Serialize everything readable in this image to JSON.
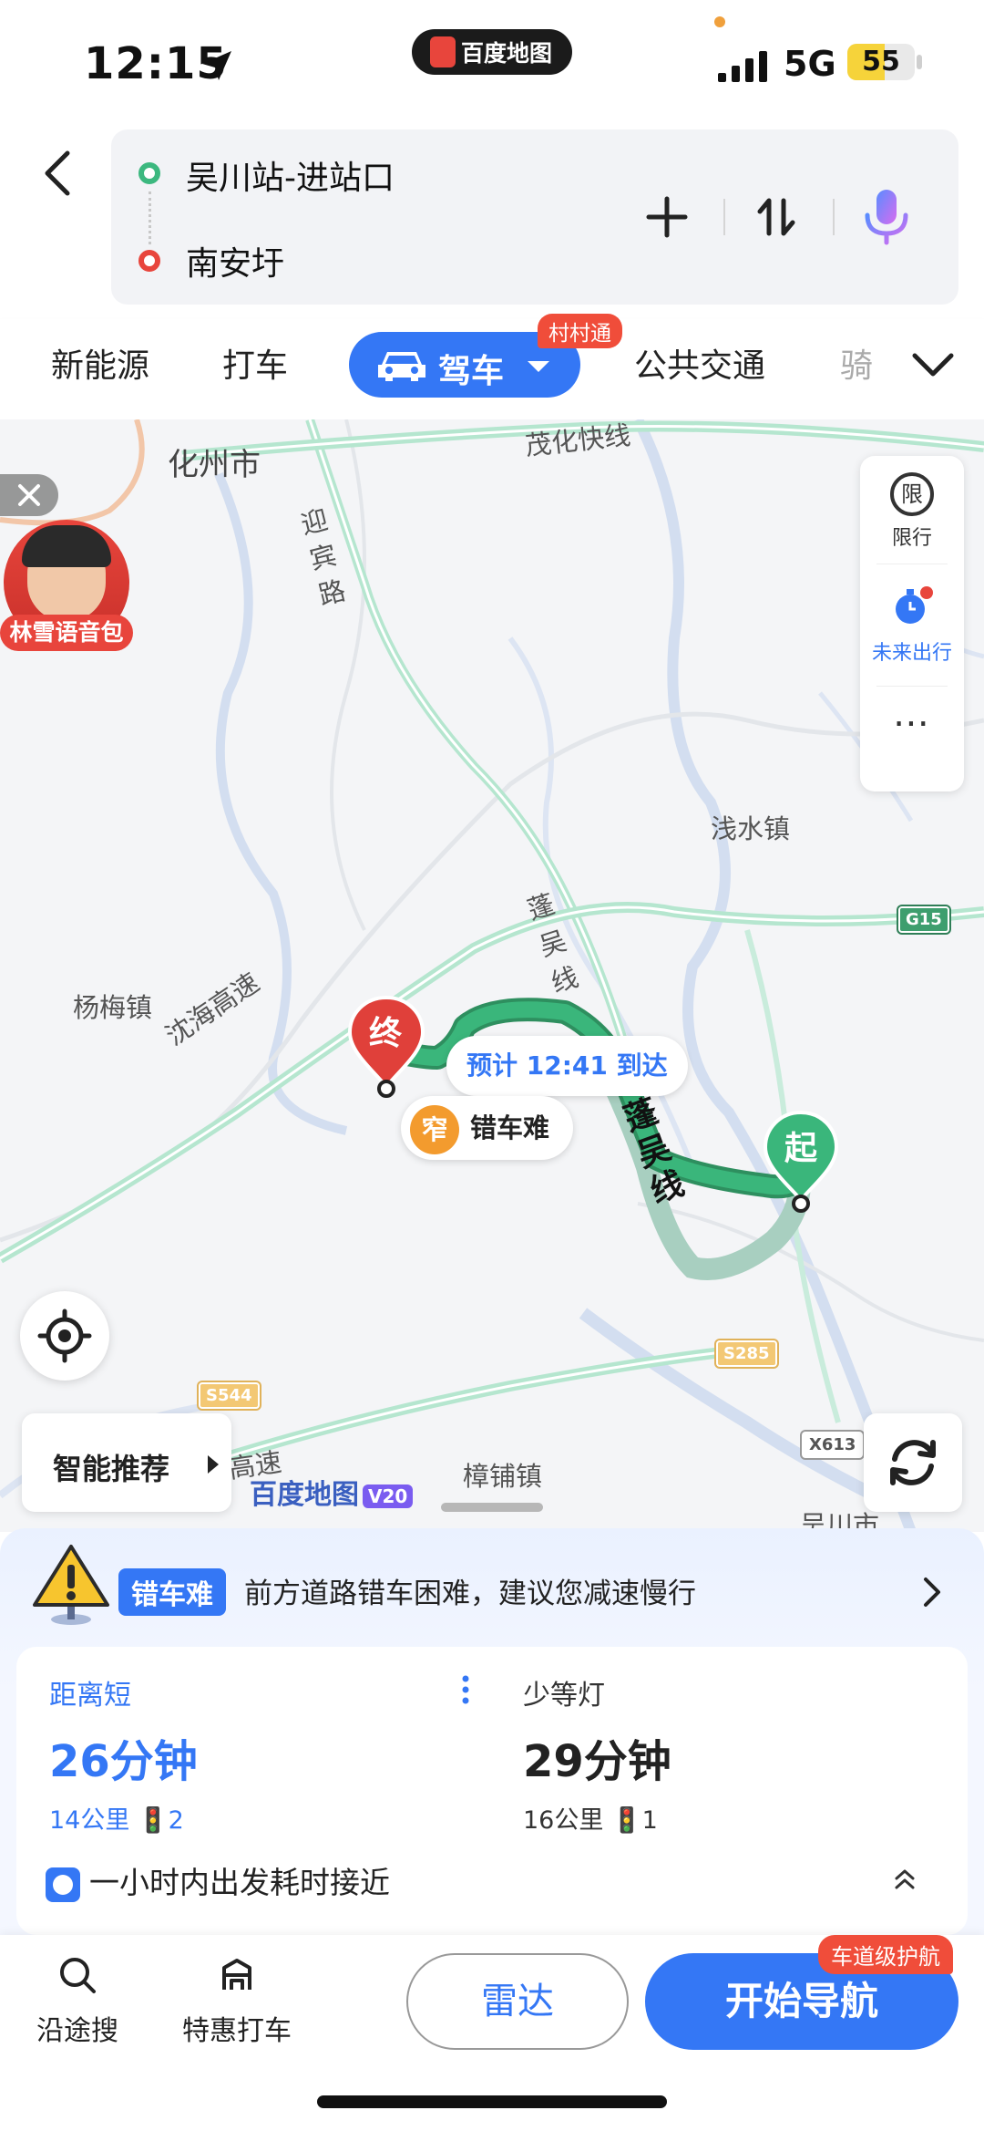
{
  "status_bar": {
    "time": "12:15",
    "app_name": "百度地图",
    "network": "5G",
    "battery": "55",
    "battery_level": 0.55
  },
  "route": {
    "from": "吴川站-进站口",
    "to": "南安圩",
    "icons": [
      "back-icon",
      "add-stop-icon",
      "swap-icon",
      "microphone-icon"
    ]
  },
  "tabs": {
    "items": [
      "新能源",
      "打车",
      "驾车",
      "公共交通",
      "骑"
    ],
    "active": "驾车",
    "active_badge": "村村通"
  },
  "map": {
    "labels": {
      "city1": "化州市",
      "expressway1": "茂化快线",
      "road1": "迎宾路",
      "town1": "浅水镇",
      "road2": "蓬吴线",
      "town2": "杨梅镇",
      "expressway2": "沈海高速",
      "expressway3": "湛高速",
      "town3": "樟铺镇",
      "city2": "吴川市"
    },
    "shields": {
      "g15": "G15",
      "s285": "S285",
      "s544": "S544",
      "x613": "X613"
    },
    "voice_pack": "林雪语音包",
    "side_panel": {
      "restrict_icon": "限",
      "restrict": "限行",
      "future": "未来出行",
      "more": "⋯"
    },
    "end_marker": "终",
    "start_marker": "起",
    "eta": "预计 12:41 到达",
    "narrow_icon": "窄",
    "narrow_text": "错车难",
    "route_label": "蓬吴线",
    "smart_recommend": "智能推荐",
    "logo": "百度地图",
    "logo_version": "V20",
    "colors": {
      "route_active": "#3ab67b",
      "route_alt": "#a8cfc0",
      "accent": "#3477f5"
    }
  },
  "warning": {
    "tag": "错车难",
    "text": "前方道路错车困难，建议您减速慢行"
  },
  "options": [
    {
      "title": "距离短",
      "time": "26分钟",
      "distance": "14公里",
      "lights": "2"
    },
    {
      "title": "少等灯",
      "time": "29分钟",
      "distance": "16公里",
      "lights": "1"
    }
  ],
  "hint": "一小时内出发耗时接近",
  "bottom_bar": {
    "search_along": "沿途搜",
    "cheap_taxi": "特惠打车",
    "radar": "雷达",
    "start_nav": "开始导航",
    "nav_badge": "车道级护航"
  }
}
